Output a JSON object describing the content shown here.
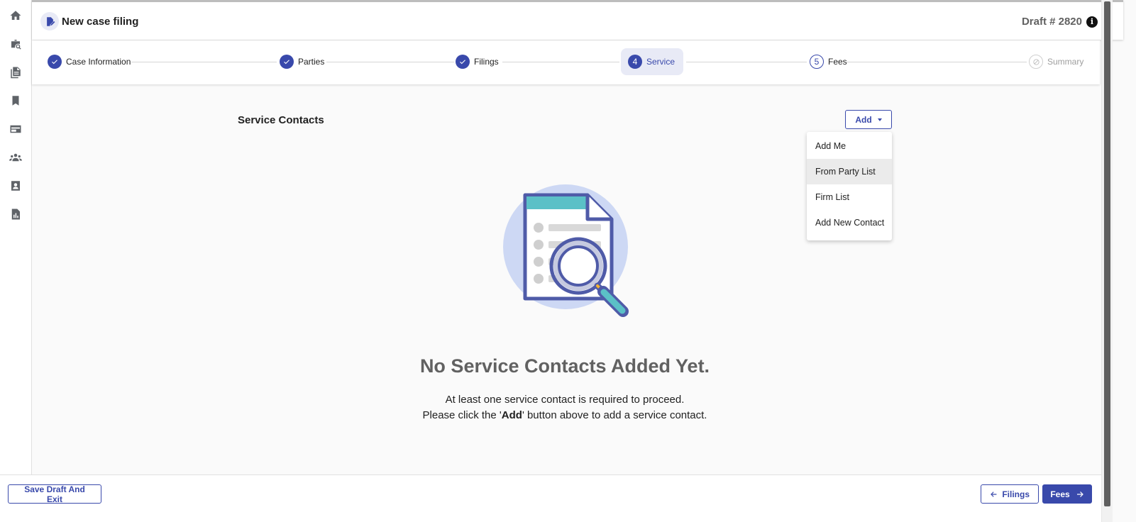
{
  "header": {
    "title": "New case filing",
    "draft": "Draft # 2820",
    "info_glyph": "i"
  },
  "nav_rail": {
    "icons": [
      "home-icon",
      "briefcase-search-icon",
      "documents-icon",
      "bookmark-icon",
      "card-icon",
      "people-icon",
      "contact-card-icon",
      "report-icon"
    ]
  },
  "stepper": {
    "steps": [
      {
        "label": "Case Information",
        "state": "complete",
        "number": ""
      },
      {
        "label": "Parties",
        "state": "complete",
        "number": ""
      },
      {
        "label": "Filings",
        "state": "complete",
        "number": ""
      },
      {
        "label": "Service",
        "state": "active",
        "number": "4"
      },
      {
        "label": "Fees",
        "state": "todo",
        "number": "5"
      },
      {
        "label": "Summary",
        "state": "disabled",
        "number": ""
      }
    ]
  },
  "section": {
    "title": "Service Contacts",
    "add_label": "Add"
  },
  "add_menu": {
    "items": [
      "Add Me",
      "From Party List",
      "Firm List",
      "Add New Contact"
    ],
    "highlighted": "From Party List"
  },
  "empty_state": {
    "title": "No Service Contacts Added Yet.",
    "line1": "At least one service contact is required to proceed.",
    "line2_before": "Please click the '",
    "line2_bold": "Add",
    "line2_after": "' button above to add a service contact."
  },
  "footer": {
    "save_label": "Save Draft And Exit",
    "back_label": "Filings",
    "next_label": "Fees"
  },
  "colors": {
    "primary": "#3949ab",
    "illustration_circle": "#cdd8f4",
    "illustration_teal": "#5bc0c7",
    "illustration_outline": "#4f5ba8"
  }
}
